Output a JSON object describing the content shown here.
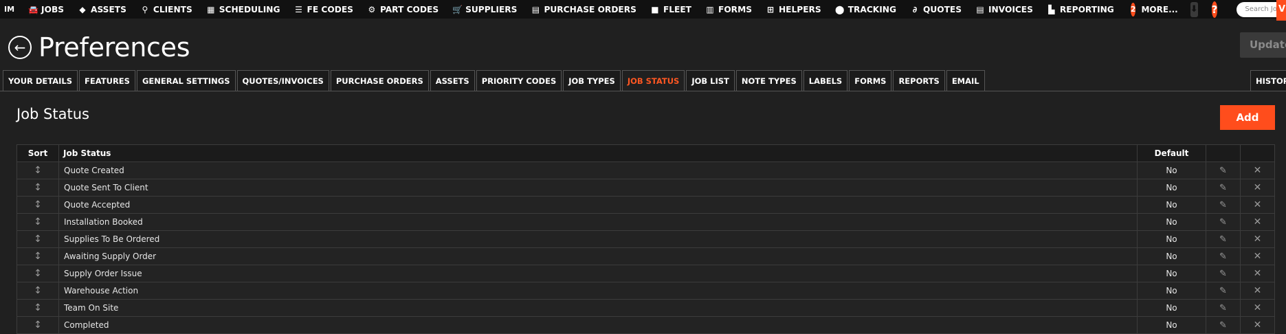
{
  "nav": {
    "brand": "IM",
    "items": [
      {
        "label": "JOBS",
        "icon": "car-icon"
      },
      {
        "label": "ASSETS",
        "icon": "cube-icon"
      },
      {
        "label": "CLIENTS",
        "icon": "sitemap-icon"
      },
      {
        "label": "SCHEDULING",
        "icon": "calendar-icon"
      },
      {
        "label": "FE CODES",
        "icon": "checklist-icon"
      },
      {
        "label": "PART CODES",
        "icon": "cogs-icon"
      },
      {
        "label": "SUPPLIERS",
        "icon": "cart-icon"
      },
      {
        "label": "PURCHASE ORDERS",
        "icon": "file-dollar-icon"
      },
      {
        "label": "FLEET",
        "icon": "truck-icon"
      },
      {
        "label": "FORMS",
        "icon": "clipboard-icon"
      },
      {
        "label": "HELPERS",
        "icon": "hierarchy-icon"
      },
      {
        "label": "TRACKING",
        "icon": "map-marker-icon"
      },
      {
        "label": "QUOTES",
        "icon": "paperclip-icon"
      },
      {
        "label": "INVOICES",
        "icon": "document-icon"
      },
      {
        "label": "REPORTING",
        "icon": "chart-icon"
      }
    ],
    "more_count": "2",
    "more_label": "MORE...",
    "help_label": "?",
    "search_placeholder": "Search Jobs",
    "right_edge_label": "V"
  },
  "header": {
    "title": "Preferences",
    "update_label": "Update"
  },
  "tabs": [
    {
      "label": "YOUR DETAILS",
      "active": false
    },
    {
      "label": "FEATURES",
      "active": false
    },
    {
      "label": "GENERAL SETTINGS",
      "active": false
    },
    {
      "label": "QUOTES/INVOICES",
      "active": false
    },
    {
      "label": "PURCHASE ORDERS",
      "active": false
    },
    {
      "label": "ASSETS",
      "active": false
    },
    {
      "label": "PRIORITY CODES",
      "active": false
    },
    {
      "label": "JOB TYPES",
      "active": false
    },
    {
      "label": "JOB STATUS",
      "active": true
    },
    {
      "label": "JOB LIST",
      "active": false
    },
    {
      "label": "NOTE TYPES",
      "active": false
    },
    {
      "label": "LABELS",
      "active": false
    },
    {
      "label": "FORMS",
      "active": false
    },
    {
      "label": "REPORTS",
      "active": false
    },
    {
      "label": "EMAIL",
      "active": false
    }
  ],
  "history_tab_label": "HISTORY",
  "panel": {
    "title": "Job Status",
    "add_label": "Add",
    "columns": {
      "sort": "Sort",
      "status": "Job Status",
      "default": "Default"
    },
    "rows": [
      {
        "status": "Quote Created",
        "default": "No"
      },
      {
        "status": "Quote Sent To Client",
        "default": "No"
      },
      {
        "status": "Quote Accepted",
        "default": "No"
      },
      {
        "status": "Installation Booked",
        "default": "No"
      },
      {
        "status": "Supplies To Be Ordered",
        "default": "No"
      },
      {
        "status": "Awaiting Supply Order",
        "default": "No"
      },
      {
        "status": "Supply Order Issue",
        "default": "No"
      },
      {
        "status": "Warehouse Action",
        "default": "No"
      },
      {
        "status": "Team On Site",
        "default": "No"
      },
      {
        "status": "Completed",
        "default": "No"
      }
    ]
  },
  "colors": {
    "accent": "#ff4d1c",
    "active_tab": "#ff5722",
    "background": "#202020",
    "nav_background": "#111111"
  }
}
